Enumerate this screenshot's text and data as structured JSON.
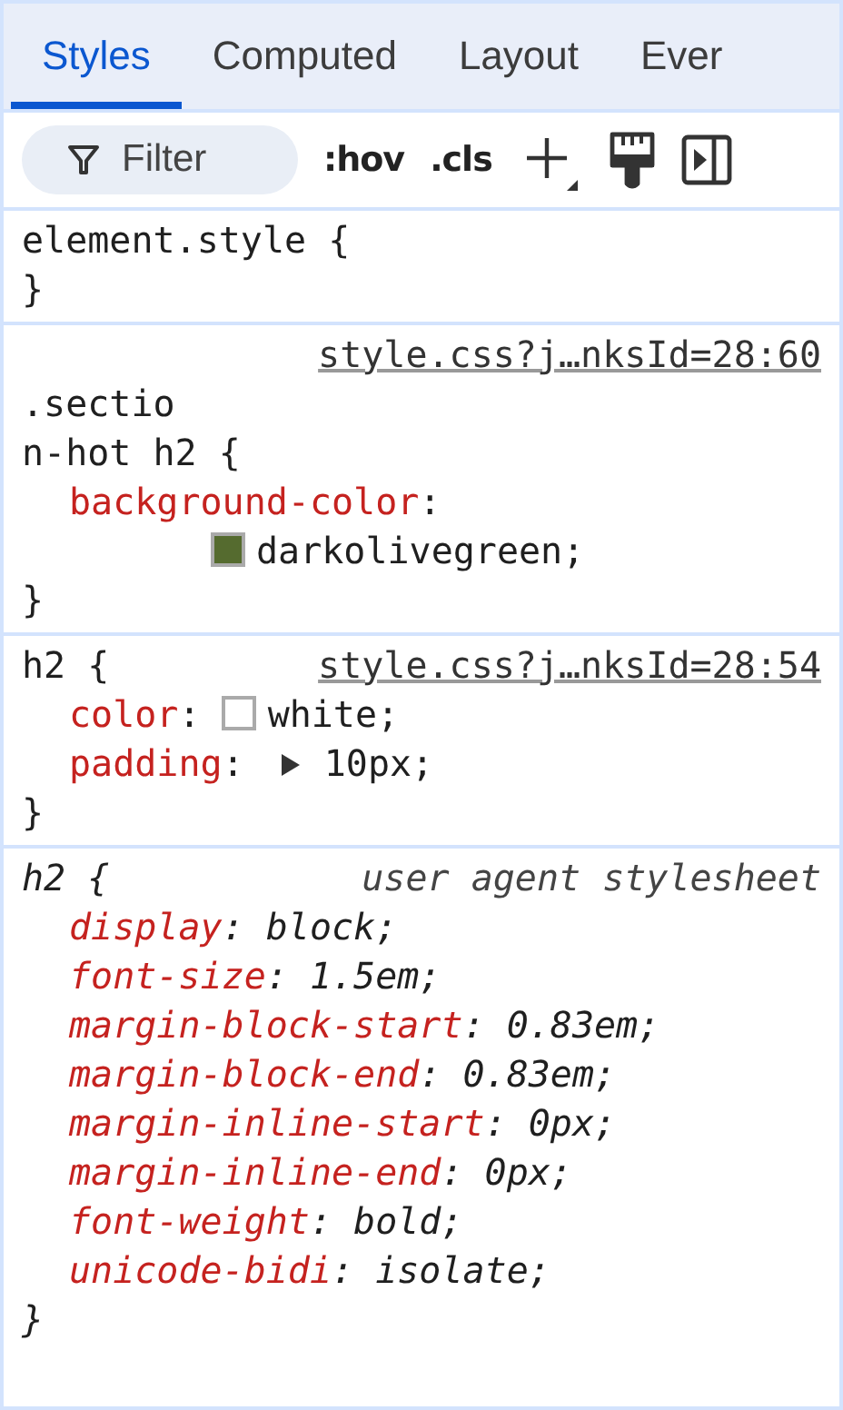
{
  "tabs": [
    {
      "label": "Styles",
      "selected": true
    },
    {
      "label": "Computed",
      "selected": false
    },
    {
      "label": "Layout",
      "selected": false
    },
    {
      "label": "Ever",
      "selected": false
    }
  ],
  "toolbar": {
    "filter": {
      "placeholder": "Filter"
    },
    "hov": ":hov",
    "cls": ".cls"
  },
  "rules": [
    {
      "kind": "author",
      "selector_lines": [
        "element.style {"
      ],
      "close": "}"
    },
    {
      "kind": "author",
      "selector_lines": [
        ".sectio",
        "n-hot h2 {"
      ],
      "source": "style.css?j…nksId=28:60",
      "source_above": true,
      "declarations": [
        {
          "name": "background-color",
          "colon": ":",
          "value": "darkolivegreen;",
          "color": "#556b2f",
          "value_wrapped": true,
          "expander": false
        }
      ],
      "close": "}"
    },
    {
      "kind": "author",
      "selector_lines": [
        "h2 {"
      ],
      "source": "style.css?j…nksId=28:54",
      "source_above": false,
      "declarations": [
        {
          "name": "color",
          "colon": ":",
          "value": "white;",
          "color": "#ffffff",
          "value_wrapped": false,
          "expander": false
        },
        {
          "name": "padding",
          "colon": ":",
          "value": "10px;",
          "value_wrapped": false,
          "expander": true
        }
      ],
      "close": "}"
    },
    {
      "kind": "user-agent",
      "selector_lines": [
        "h2 {"
      ],
      "source": "user agent stylesheet",
      "source_above": false,
      "declarations": [
        {
          "name": "display",
          "colon": ":",
          "value": "block;",
          "value_wrapped": false,
          "expander": false
        },
        {
          "name": "font-size",
          "colon": ":",
          "value": "1.5em;",
          "value_wrapped": false,
          "expander": false
        },
        {
          "name": "margin-block-start",
          "colon": ":",
          "value": "0.83em;",
          "value_wrapped": false,
          "expander": false
        },
        {
          "name": "margin-block-end",
          "colon": ":",
          "value": "0.83em;",
          "value_wrapped": false,
          "expander": false
        },
        {
          "name": "margin-inline-start",
          "colon": ":",
          "value": "0px;",
          "value_wrapped": false,
          "expander": false
        },
        {
          "name": "margin-inline-end",
          "colon": ":",
          "value": "0px;",
          "value_wrapped": false,
          "expander": false
        },
        {
          "name": "font-weight",
          "colon": ":",
          "value": "bold;",
          "value_wrapped": false,
          "expander": false
        },
        {
          "name": "unicode-bidi",
          "colon": ":",
          "value": "isolate;",
          "value_wrapped": false,
          "expander": false
        }
      ],
      "close": "}"
    }
  ]
}
